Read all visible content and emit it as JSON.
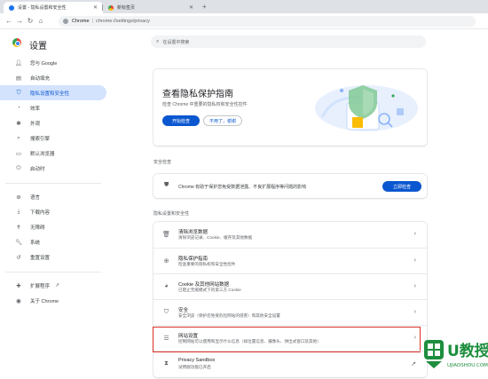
{
  "browser": {
    "tabs": [
      {
        "title": "设置 - 隐私设置和安全性",
        "active": true
      },
      {
        "title": "新标签页",
        "active": false
      }
    ],
    "address": {
      "scheme": "Chrome",
      "path": "chrome://settings/privacy"
    }
  },
  "header": {
    "title": "设置",
    "search_placeholder": "在设置中搜索"
  },
  "sidebar": {
    "items": [
      {
        "label": "您与 Google",
        "icon": "person-icon"
      },
      {
        "label": "自动填充",
        "icon": "autofill-icon"
      },
      {
        "label": "隐私设置和安全性",
        "icon": "shield-icon",
        "active": true
      },
      {
        "label": "效率",
        "icon": "speedometer-icon"
      },
      {
        "label": "外观",
        "icon": "palette-icon"
      },
      {
        "label": "搜索引擎",
        "icon": "search-icon"
      },
      {
        "label": "默认浏览器",
        "icon": "browser-icon"
      },
      {
        "label": "启动时",
        "icon": "power-icon"
      }
    ],
    "advanced": [
      {
        "label": "语言",
        "icon": "globe-icon"
      },
      {
        "label": "下载内容",
        "icon": "download-icon"
      },
      {
        "label": "无障碍",
        "icon": "accessibility-icon"
      },
      {
        "label": "系统",
        "icon": "wrench-icon"
      },
      {
        "label": "重置设置",
        "icon": "reset-icon"
      }
    ],
    "extensions_label": "扩展程序",
    "about_label": "关于 Chrome"
  },
  "promo": {
    "title": "查看隐私保护指南",
    "description": "检查 Chrome 中重要的隐私权和安全性控件",
    "primary_button": "开始检查",
    "secondary_button": "不用了，谢谢"
  },
  "safety": {
    "section_label": "安全检查",
    "text": "Chrome 有助于保护您免受数据泄露、不良扩展程序等问题的影响",
    "button": "立即检查"
  },
  "privacy": {
    "section_label": "隐私设置和安全性",
    "rows": [
      {
        "title": "清除浏览数据",
        "subtitle": "清除浏览记录、Cookie、缓存及其他数据",
        "icon": "trash-icon"
      },
      {
        "title": "隐私保护指南",
        "subtitle": "检查重要的隐私权和安全性控件",
        "icon": "privacy-guide-icon"
      },
      {
        "title": "Cookie 及其他网站数据",
        "subtitle": "已阻止无痕模式下的第三方 Cookie",
        "icon": "cookie-icon"
      },
      {
        "title": "安全",
        "subtitle": "安全浏览（保护您免受危险网站的侵害）和其他安全设置",
        "icon": "security-shield-icon"
      },
      {
        "title": "网站设置",
        "subtitle": "控制网站可以使用和显示什么信息（如位置信息、摄像头、弹出式窗口及其他）",
        "icon": "sliders-icon",
        "highlighted": true
      },
      {
        "title": "Privacy Sandbox",
        "subtitle": "试用版功能已开启",
        "icon": "sandbox-icon"
      }
    ]
  },
  "watermark": {
    "brand": "U教授",
    "url": "UJIAOSHOU.COM"
  },
  "colors": {
    "accent": "#0b57d0",
    "nav_active_bg": "#d3e3fd",
    "highlight_border": "#d93025",
    "watermark_green": "#1e8e3e"
  }
}
